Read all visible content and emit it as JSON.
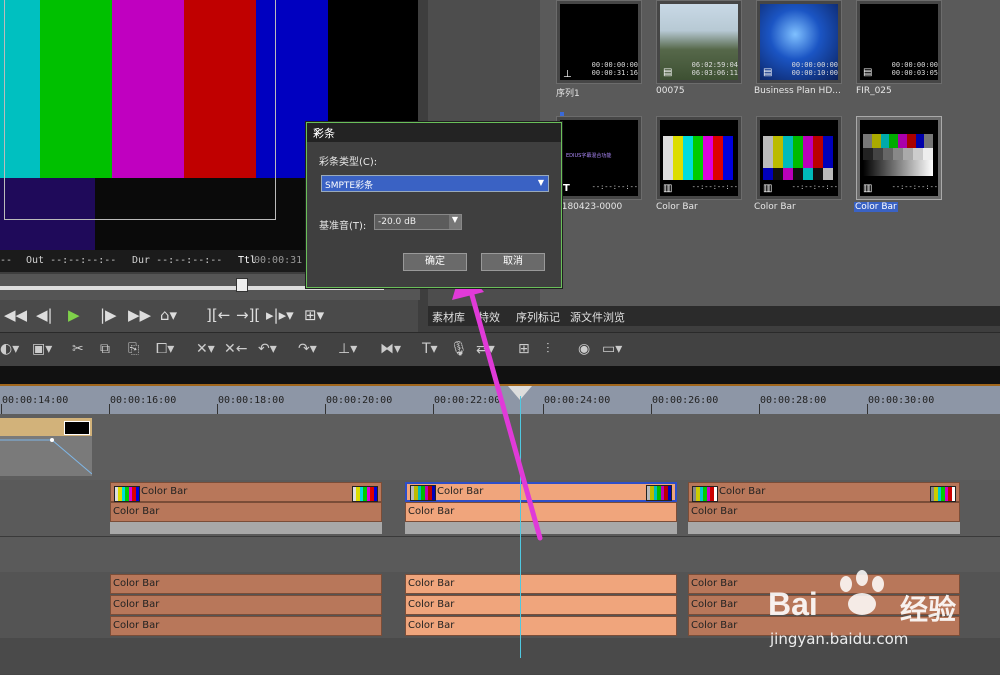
{
  "preview": {
    "timecodes": {
      "out": "Out --:--:--:--",
      "dur": "Dur --:--:--:--",
      "ttl_label": "Ttl",
      "ttl_value": "00:00:31"
    }
  },
  "bin": {
    "items": [
      {
        "label": "序列1",
        "tc1": "00:00:00:00",
        "tc2": "00:00:31:16",
        "icon": "sequence-icon"
      },
      {
        "label": "00075",
        "tc1": "06:02:59:04",
        "tc2": "06:03:06:11",
        "icon": "film-icon"
      },
      {
        "label": "Business Plan HD...",
        "tc1": "00:00:00:00",
        "tc2": "00:00:10:00",
        "icon": "film-icon"
      },
      {
        "label": "FIR_025",
        "tc1": "00:00:00:00",
        "tc2": "00:00:03:05",
        "icon": "film-icon"
      },
      {
        "label": "0180423-0000",
        "tc1": "--:--:--:--",
        "icon": "title-icon",
        "screen_text": "EDIUS字幕混合功能"
      },
      {
        "label": "Color Bar",
        "tc1": "--:--:--:--",
        "icon": "colorbar-icon"
      },
      {
        "label": "Color Bar",
        "tc1": "--:--:--:--",
        "icon": "colorbar-icon"
      },
      {
        "label": "Color Bar",
        "tc1": "--:--:--:--",
        "icon": "colorbar-icon",
        "selected": true
      }
    ],
    "tabs": [
      "素材库",
      "特效",
      "序列标记",
      "源文件浏览"
    ]
  },
  "timeline": {
    "ruler": [
      "00:00:14:00",
      "00:00:16:00",
      "00:00:18:00",
      "00:00:20:00",
      "00:00:22:00",
      "00:00:24:00",
      "00:00:26:00",
      "00:00:28:00",
      "00:00:30:00"
    ],
    "clip_label": "Color Bar"
  },
  "dialog": {
    "title": "彩条",
    "type_label": "彩条类型(C):",
    "type_value": "SMPTE彩条",
    "ref_label": "基准音(T):",
    "ref_value": "-20.0 dB",
    "ok": "确定",
    "cancel": "取消"
  },
  "watermark": {
    "brand": "Bai",
    "brand2": "经验",
    "url": "jingyan.baidu.com"
  },
  "colors": {
    "accent_arrow": "#e03ad8",
    "clip": "#b8775a",
    "clip_selected": "#f0a57c",
    "playhead": "#50c8e0",
    "dialog_border": "#6abf5a"
  }
}
